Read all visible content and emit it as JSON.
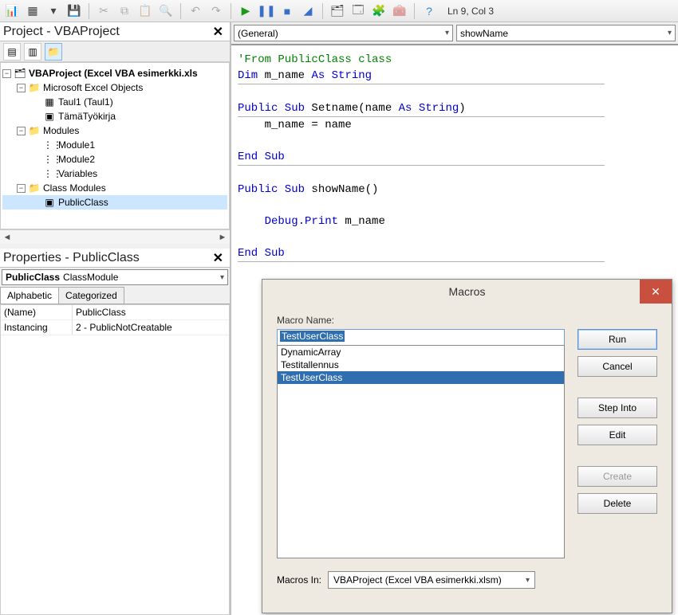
{
  "toolbar": {
    "status": "Ln 9, Col 3"
  },
  "project": {
    "title": "Project - VBAProject",
    "root": "VBAProject (Excel VBA esimerkki.xls",
    "groups": {
      "excel_objects": "Microsoft Excel Objects",
      "modules": "Modules",
      "class_modules": "Class Modules"
    },
    "items": {
      "taul1": "Taul1 (Taul1)",
      "workbook": "TämäTyökirja",
      "module1": "Module1",
      "module2": "Module2",
      "variables": "Variables",
      "publicclass": "PublicClass"
    }
  },
  "properties": {
    "title": "Properties - PublicClass",
    "combo_name": "PublicClass",
    "combo_type": "ClassModule",
    "tabs": {
      "alphabetic": "Alphabetic",
      "categorized": "Categorized"
    },
    "rows": [
      {
        "key": "(Name)",
        "value": "PublicClass"
      },
      {
        "key": "Instancing",
        "value": "2 - PublicNotCreatable"
      }
    ]
  },
  "editor": {
    "combo_left": "(General)",
    "combo_right": "showName",
    "code": {
      "comment": "'From PublicClass class",
      "l2a": "Dim",
      "l2b": " m_name ",
      "l2c": "As String",
      "l3a": "Public Sub",
      "l3b": " Setname(name ",
      "l3c": "As String",
      "l3d": ")",
      "l4": "    m_name = name",
      "l5": "End Sub",
      "l6a": "Public Sub",
      "l6b": " showName()",
      "l7a": "    Debug.Print",
      "l7b": " m_name",
      "l8": "End Sub"
    }
  },
  "dialog": {
    "title": "Macros",
    "label": "Macro Name:",
    "input_value": "TestUserClass",
    "items": [
      "DynamicArray",
      "Testitallennus",
      "TestUserClass"
    ],
    "selected_index": 2,
    "buttons": {
      "run": "Run",
      "cancel": "Cancel",
      "step_into": "Step Into",
      "edit": "Edit",
      "create": "Create",
      "delete": "Delete"
    },
    "macros_in_label": "Macros In:",
    "macros_in_value": "VBAProject (Excel VBA esimerkki.xlsm)"
  }
}
